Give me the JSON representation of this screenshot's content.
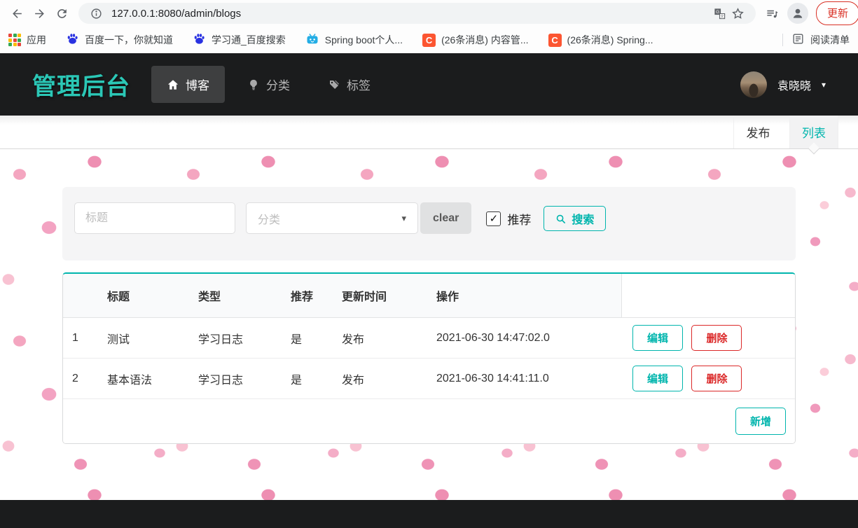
{
  "browser": {
    "url": "127.0.0.1:8080/admin/blogs",
    "update_label": "更新",
    "reading_list_label": "阅读清单",
    "bookmarks": [
      {
        "label": "应用",
        "icon": "apps-grid-icon"
      },
      {
        "label": "百度一下，你就知道",
        "icon": "baidu-icon"
      },
      {
        "label": "学习通_百度搜索",
        "icon": "baidu-icon"
      },
      {
        "label": "Spring boot个人...",
        "icon": "bilibili-icon"
      },
      {
        "label": "(26条消息) 内容管...",
        "icon": "csdn-icon"
      },
      {
        "label": "(26条消息) Spring...",
        "icon": "csdn-icon"
      }
    ]
  },
  "icons": {
    "csdn_letter": "C",
    "caret_down": "▾",
    "check": "✓",
    "user_caret": "▾"
  },
  "navbar": {
    "logo": "管理后台",
    "items": [
      {
        "label": "博客",
        "icon": "home-icon",
        "active": true
      },
      {
        "label": "分类",
        "icon": "idea-icon",
        "active": false
      },
      {
        "label": "标签",
        "icon": "tags-icon",
        "active": false
      }
    ],
    "user": {
      "name": "袁晓晓"
    }
  },
  "subnav": {
    "tabs": [
      {
        "label": "发布",
        "active": false
      },
      {
        "label": "列表",
        "active": true
      }
    ]
  },
  "filter": {
    "title_placeholder": "标题",
    "category_placeholder": "分类",
    "clear_label": "clear",
    "recommend_label": "推荐",
    "recommend_checked": true,
    "search_label": "搜索"
  },
  "table": {
    "headers": [
      "",
      "标题",
      "类型",
      "推荐",
      "更新时间",
      "操作"
    ],
    "rows": [
      {
        "index": "1",
        "title": "测试",
        "type": "学习日志",
        "recommend": "是",
        "status": "发布",
        "updated": "2021-06-30 14:47:02.0",
        "edit_label": "编辑",
        "delete_label": "删除"
      },
      {
        "index": "2",
        "title": "基本语法",
        "type": "学习日志",
        "recommend": "是",
        "status": "发布",
        "updated": "2021-06-30 14:41:11.0",
        "edit_label": "编辑",
        "delete_label": "删除"
      }
    ],
    "add_label": "新增"
  },
  "colors": {
    "teal": "#00b5ad",
    "red": "#db2828",
    "dark_bar": "#1b1c1d",
    "logo_teal": "#2bc7b6",
    "dot_pink": "#f4a6c0"
  }
}
